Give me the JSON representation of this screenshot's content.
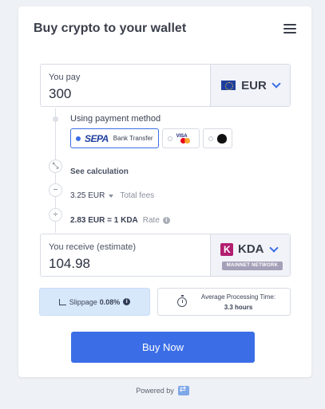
{
  "header": {
    "title": "Buy crypto to your wallet",
    "menu_icon": "hamburger-menu-icon"
  },
  "pay": {
    "label": "You pay",
    "value": "300",
    "currency": "EUR",
    "flag_icon": "eu-flag-icon"
  },
  "payment_method": {
    "label": "Using payment method",
    "options": [
      {
        "name": "SEPA",
        "text": "Bank Transfer",
        "selected": true,
        "icon": "sepa-logo-icon"
      },
      {
        "name": "Card",
        "text": "",
        "selected": false,
        "icon": "visa-mastercard-icon"
      },
      {
        "name": "Apple Pay",
        "text": "",
        "selected": false,
        "icon": "apple-icon"
      }
    ]
  },
  "calculation": {
    "see_label": "See calculation",
    "fee_amount": "3.25 EUR",
    "fee_label": "Total fees",
    "rate_value": "2.83 EUR = 1 KDA",
    "rate_label": "Rate"
  },
  "receive": {
    "label": "You receive (estimate)",
    "value": "104.98",
    "currency": "KDA",
    "network_badge": "MAINNET NETWORK"
  },
  "slippage": {
    "label": "Slippage",
    "value": "0.08%"
  },
  "processing": {
    "label": "Average Processing Time:",
    "value": "3.3 hours"
  },
  "buy_button": {
    "label": "Buy Now"
  },
  "footer": {
    "powered_by": "Powered by"
  },
  "colors": {
    "accent": "#3b6ee6",
    "slippage_bg": "#d8e8fb",
    "kda_brand": "#b21f6f"
  }
}
